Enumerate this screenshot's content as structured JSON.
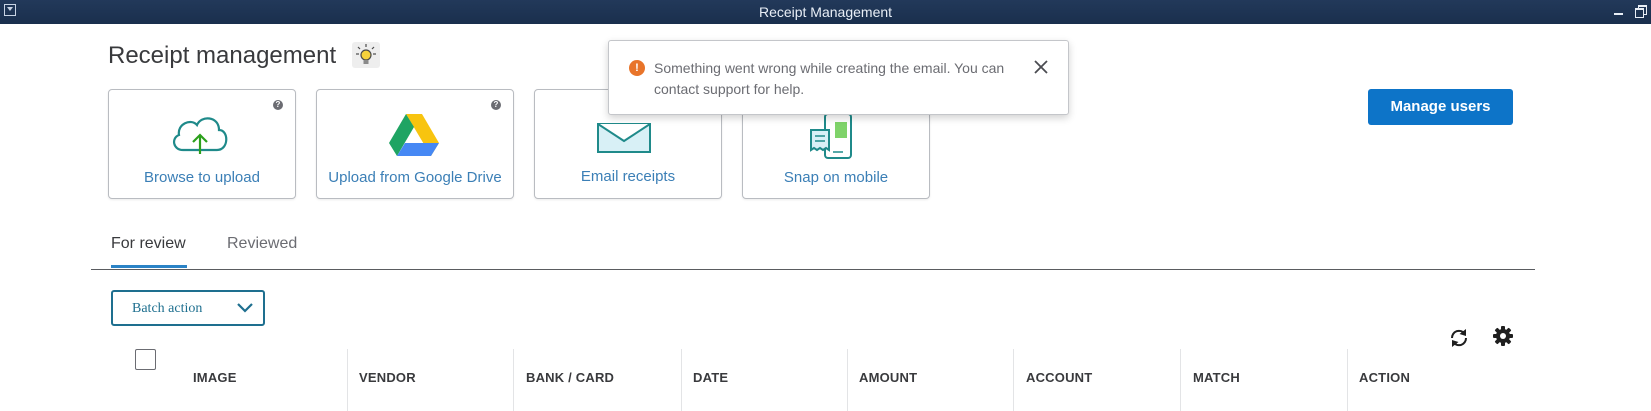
{
  "window": {
    "title": "Receipt Management"
  },
  "page": {
    "title": "Receipt management"
  },
  "upload_tiles": [
    {
      "label": "Browse to upload",
      "has_help": true
    },
    {
      "label": "Upload from Google Drive",
      "has_help": true
    },
    {
      "label": "Email receipts",
      "has_help": false
    },
    {
      "label": "Snap on mobile",
      "has_help": false
    }
  ],
  "help_glyph": "?",
  "toast": {
    "icon_glyph": "!",
    "message": "Something went wrong while creating the email. You can contact support for help."
  },
  "manage_users_label": "Manage users",
  "tabs": [
    {
      "label": "For review",
      "active": true
    },
    {
      "label": "Reviewed",
      "active": false
    }
  ],
  "batch_action": {
    "label": "Batch action"
  },
  "table": {
    "columns": [
      "IMAGE",
      "VENDOR",
      "BANK / CARD",
      "DATE",
      "AMOUNT",
      "ACCOUNT",
      "MATCH",
      "ACTION"
    ]
  },
  "colors": {
    "titlebar": "#1d3557",
    "primary_button": "#0d74c8",
    "link_blue": "#3b7fb6",
    "warning": "#e8742a",
    "tab_active": "#2b83c6",
    "batch_border": "#1e6f8f"
  },
  "icons": {
    "tile_0": "cloud-upload-icon",
    "tile_1": "google-drive-icon",
    "tile_2": "envelope-icon",
    "tile_3": "phone-receipt-icon",
    "tip": "lightbulb-icon",
    "toast_close": "close-icon",
    "refresh": "refresh-icon",
    "settings": "gear-icon"
  }
}
